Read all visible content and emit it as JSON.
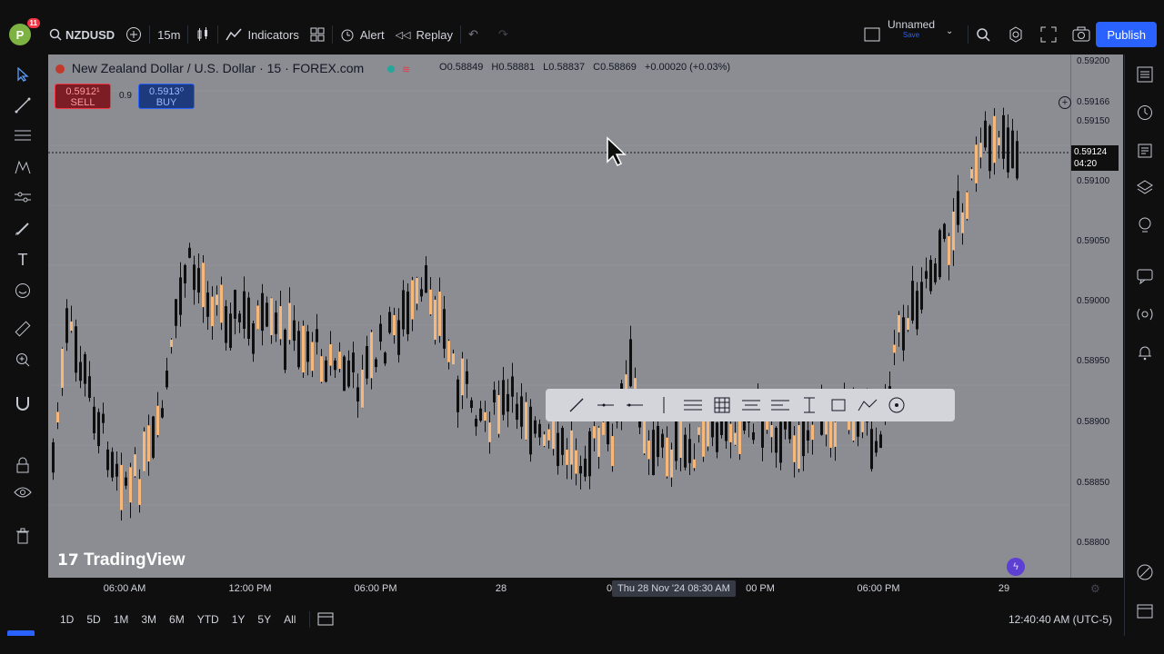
{
  "topbar": {
    "avatar_letter": "P",
    "avatar_badge": "11",
    "symbol": "NZDUSD",
    "interval": "15m",
    "indicators_label": "Indicators",
    "alert_label": "Alert",
    "replay_label": "Replay",
    "layout_name": "Unnamed",
    "layout_save": "Save",
    "publish_label": "Publish"
  },
  "chart": {
    "symbol_title": "New Zealand Dollar / U.S. Dollar · 15 · FOREX.com",
    "ohlc": {
      "o_label": "O",
      "o": "0.58849",
      "h_label": "H",
      "h": "0.58881",
      "l_label": "L",
      "l": "0.58837",
      "c_label": "C",
      "c": "0.58869",
      "change": "+0.00020 (+0.03%)"
    },
    "sell_price": "0.5912¹",
    "sell_label": "SELL",
    "spread": "0.9",
    "buy_price": "0.5913⁰",
    "buy_label": "BUY",
    "watermark": "TradingView"
  },
  "price_axis": {
    "labels": [
      "0.59200",
      "0.59166",
      "0.59150",
      "0.59100",
      "0.59050",
      "0.59000",
      "0.58950",
      "0.58900",
      "0.58850",
      "0.58800"
    ],
    "current_price": "0.59124",
    "countdown": "04:20"
  },
  "time_axis": {
    "labels": [
      "06:00 AM",
      "12:00 PM",
      "06:00 PM",
      "28",
      "0",
      "00 PM",
      "06:00 PM",
      "29"
    ],
    "hover_label": "Thu 28 Nov '24   08:30 AM"
  },
  "bottom": {
    "ranges": [
      "1D",
      "5D",
      "1M",
      "3M",
      "6M",
      "YTD",
      "1Y",
      "5Y",
      "All"
    ],
    "clock": "12:40:40 AM (UTC-5)"
  },
  "icons": {
    "left": [
      "cursor-icon",
      "trendline-icon",
      "fib-icon",
      "pattern-icon",
      "prediction-icon",
      "brush-icon",
      "text-icon",
      "emoji-icon",
      "ruler-icon",
      "zoom-icon",
      "magnet-icon",
      "lock-icon",
      "eye-icon",
      "trash-icon"
    ],
    "right": [
      "watchlist-icon",
      "alerts-icon",
      "news-icon",
      "layers-icon",
      "ideas-icon",
      "chat-icon",
      "stream-icon",
      "notifications-icon",
      "target-icon",
      "calendar-icon"
    ]
  },
  "colors": {
    "chart_bg": "#8b8d93",
    "candle_up": "#f5b87a",
    "candle_down": "#0f0f0f",
    "accent": "#2962ff",
    "sell": "#f23645"
  }
}
